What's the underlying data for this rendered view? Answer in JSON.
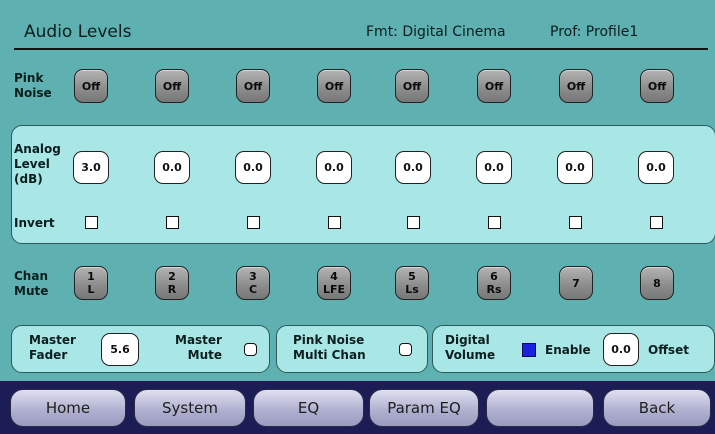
{
  "header": {
    "title": "Audio Levels",
    "format": "Fmt: Digital Cinema",
    "profile": "Prof: Profile1"
  },
  "pink_noise": {
    "label_line1": "Pink",
    "label_line2": "Noise",
    "buttons": [
      "Off",
      "Off",
      "Off",
      "Off",
      "Off",
      "Off",
      "Off",
      "Off"
    ]
  },
  "analog_level": {
    "label_line1": "Analog",
    "label_line2": "Level",
    "label_line3": "(dB)",
    "values": [
      "3.0",
      "0.0",
      "0.0",
      "0.0",
      "0.0",
      "0.0",
      "0.0",
      "0.0"
    ]
  },
  "invert": {
    "label": "Invert",
    "checked": [
      false,
      false,
      false,
      false,
      false,
      false,
      false,
      false
    ]
  },
  "chan_mute": {
    "label_line1": "Chan",
    "label_line2": "Mute",
    "channels": [
      {
        "num": "1",
        "name": "L"
      },
      {
        "num": "2",
        "name": "R"
      },
      {
        "num": "3",
        "name": "C"
      },
      {
        "num": "4",
        "name": "LFE"
      },
      {
        "num": "5",
        "name": "Ls"
      },
      {
        "num": "6",
        "name": "Rs"
      },
      {
        "num": "7",
        "name": ""
      },
      {
        "num": "8",
        "name": ""
      }
    ]
  },
  "master": {
    "fader_line1": "Master",
    "fader_line2": "Fader",
    "fader_value": "5.6",
    "mute_line1": "Master",
    "mute_line2": "Mute"
  },
  "pink_multi": {
    "line1": "Pink Noise",
    "line2": "Multi Chan"
  },
  "digital_volume": {
    "line1": "Digital",
    "line2": "Volume",
    "enable_label": "Enable",
    "enabled": true,
    "offset_value": "0.0",
    "offset_label": "Offset"
  },
  "nav": {
    "home": "Home",
    "system": "System",
    "eq": "EQ",
    "param_eq": "Param EQ",
    "blank": "",
    "back": "Back"
  },
  "colors": {
    "background": "#5fb0b0",
    "panel": "#a9e6e6",
    "navbar": "#1c1d55",
    "enable_indicator": "#1a22dd"
  }
}
